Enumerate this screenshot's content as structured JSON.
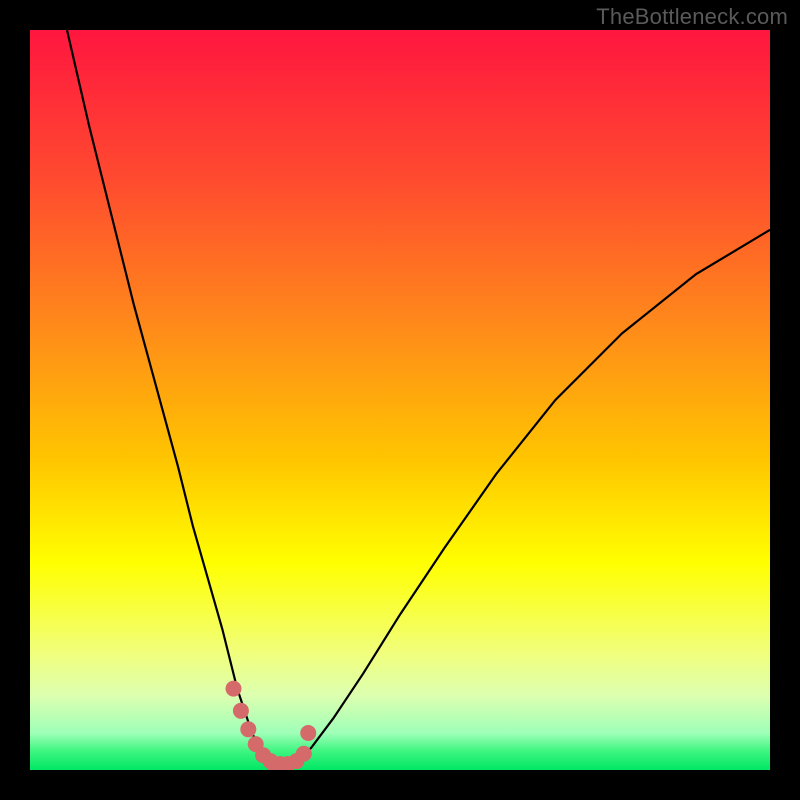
{
  "watermark": "TheBottleneck.com",
  "chart_data": {
    "type": "line",
    "title": "",
    "xlabel": "",
    "ylabel": "",
    "xlim": [
      0,
      100
    ],
    "ylim": [
      0,
      100
    ],
    "gradient_stops": [
      {
        "offset": 0.0,
        "color": "#ff163f"
      },
      {
        "offset": 0.2,
        "color": "#ff4a2f"
      },
      {
        "offset": 0.4,
        "color": "#ff8a1a"
      },
      {
        "offset": 0.58,
        "color": "#ffc500"
      },
      {
        "offset": 0.72,
        "color": "#ffff00"
      },
      {
        "offset": 0.84,
        "color": "#f1ff7a"
      },
      {
        "offset": 0.9,
        "color": "#dcffb0"
      },
      {
        "offset": 0.95,
        "color": "#9fffb8"
      },
      {
        "offset": 0.975,
        "color": "#3cf57f"
      },
      {
        "offset": 1.0,
        "color": "#00e765"
      }
    ],
    "series": [
      {
        "name": "left-branch",
        "color": "#000000",
        "x": [
          5,
          8,
          11,
          14,
          17,
          20,
          22,
          24,
          26,
          27,
          28,
          29,
          30,
          31,
          32
        ],
        "y": [
          100,
          87,
          75,
          63,
          52,
          41,
          33,
          26,
          19,
          15,
          11,
          8,
          5,
          3,
          1
        ]
      },
      {
        "name": "right-branch",
        "color": "#000000",
        "x": [
          36,
          38,
          41,
          45,
          50,
          56,
          63,
          71,
          80,
          90,
          100
        ],
        "y": [
          1,
          3,
          7,
          13,
          21,
          30,
          40,
          50,
          59,
          67,
          73
        ]
      },
      {
        "name": "valley-markers",
        "color": "#d46a6a",
        "marker_radius": 8,
        "x": [
          27.5,
          28.5,
          29.5,
          30.5,
          31.5,
          32.5,
          33.0,
          33.8,
          34.8,
          36.0,
          37.0,
          37.6
        ],
        "y": [
          11.0,
          8.0,
          5.5,
          3.5,
          2.0,
          1.2,
          0.8,
          0.8,
          0.8,
          1.2,
          2.2,
          5.0
        ]
      }
    ]
  }
}
